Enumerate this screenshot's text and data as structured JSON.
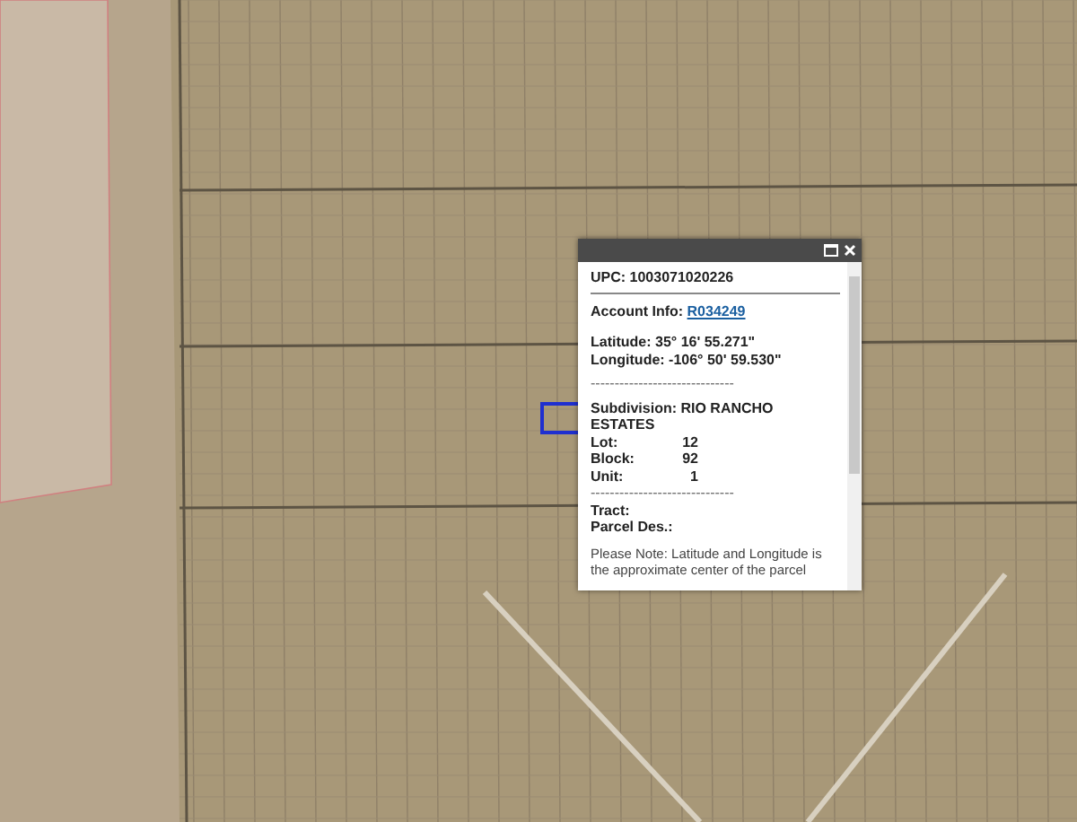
{
  "popup": {
    "upc": "UPC: 1003071020226",
    "account": {
      "label": "Account Info:",
      "link": "R034249"
    },
    "coordinates": [
      "Latitude: 35° 16' 55.271\"",
      "Longitude: -106° 50' 59.530\""
    ],
    "separator": "------------------------------",
    "subdivision": "Subdivision: RIO RANCHO ESTATES",
    "details": [
      {
        "label": "Lot:",
        "value": "12"
      },
      {
        "label": "Block:",
        "value": "92"
      },
      {
        "label": "Unit:",
        "value": "1"
      }
    ],
    "separator_2": "------------------------------",
    "extra": [
      "Tract:",
      "Parcel Des.:"
    ],
    "note": "Please Note: Latitude and Longitude is the approximate center of the parcel"
  }
}
